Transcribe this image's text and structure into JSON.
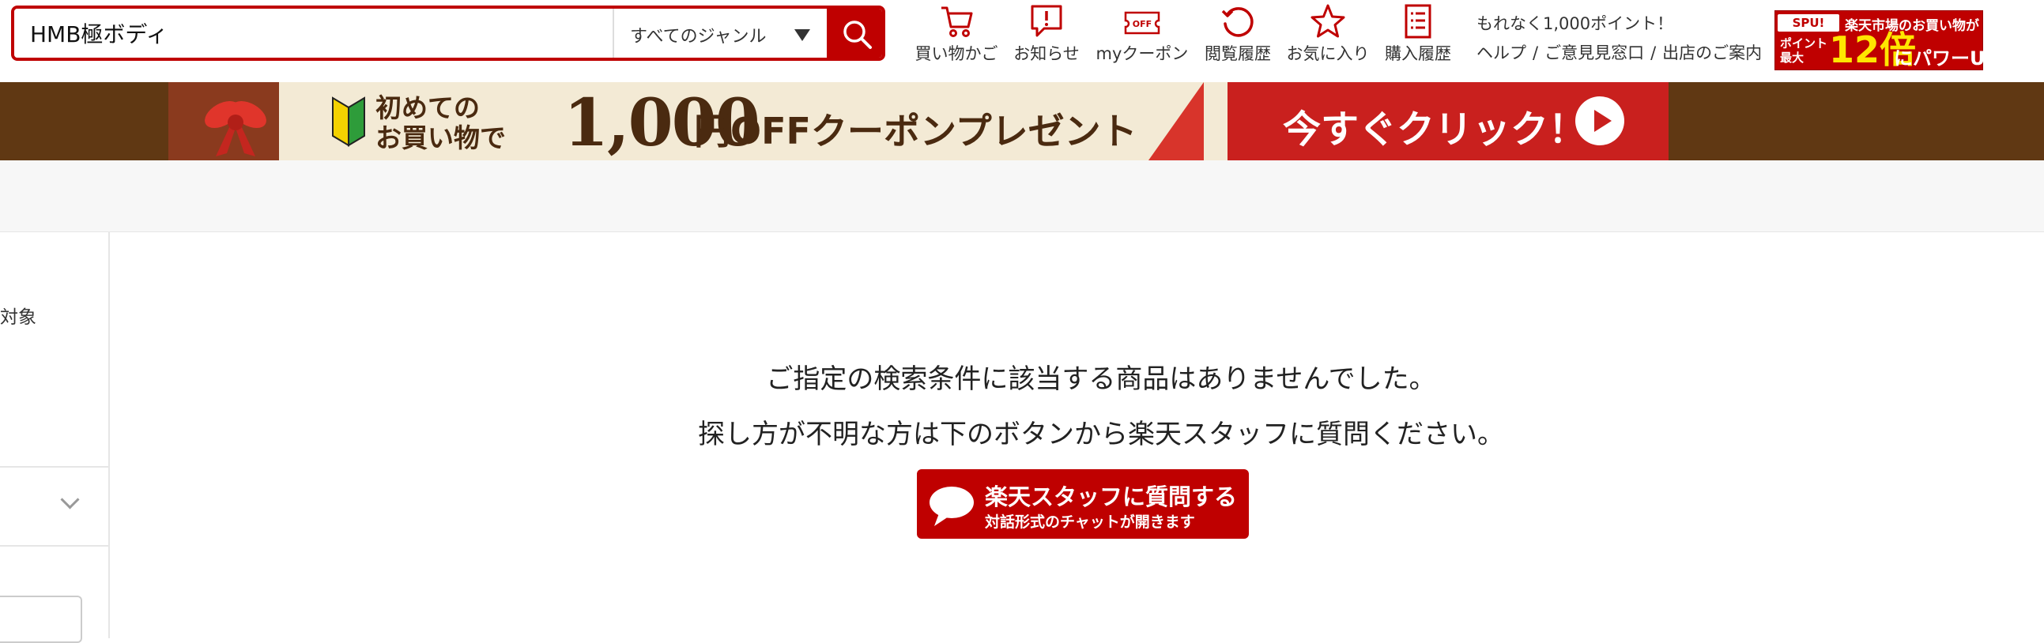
{
  "search": {
    "value": "HMB極ボディ",
    "genre": "すべてのジャンル"
  },
  "nav": {
    "cart": "買い物かご",
    "notices": "お知らせ",
    "coupon": "myクーポン",
    "history": "閲覧履歴",
    "favorites": "お気に入り",
    "purchase_history": "購入履歴",
    "coupon_icon_text": "OFF"
  },
  "header": {
    "points_text": "もれなく1,000ポイント！",
    "help": "ヘルプ",
    "feedback": "ご意見見窓口",
    "store_guide": "出店のご案内",
    "separator": "/"
  },
  "spu": {
    "logo": "SPU!",
    "top_text": "楽天市場のお買い物が",
    "point_text": "ポイント 最大",
    "multiplier": "12倍",
    "power_text": "にパワーUP!"
  },
  "promo": {
    "small_text_line1": "初めての",
    "small_text_line2": "お買い物で",
    "amount": "1,000",
    "rest": "円OFFクーポンプレゼント",
    "cta": "今すぐクリック！"
  },
  "sidebar": {
    "text": "対象"
  },
  "main": {
    "message1": "ご指定の検索条件に該当する商品はありませんでした。",
    "message2": "探し方が不明な方は下のボタンから楽天スタッフに質問ください。",
    "ask_main": "楽天スタッフに質問する",
    "ask_sub": "対話形式のチャットが開きます"
  },
  "colors": {
    "brand_red": "#bf0000",
    "banner_brown": "#603813"
  }
}
